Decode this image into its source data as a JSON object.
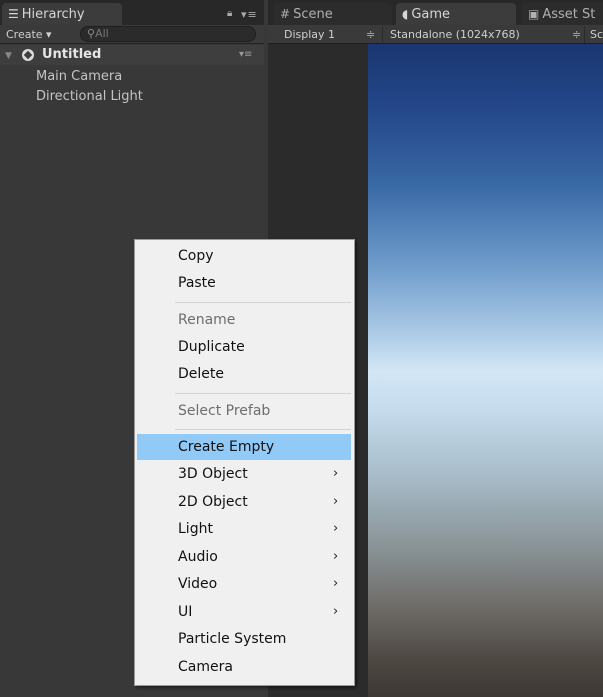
{
  "hierarchy": {
    "tab_label": "Hierarchy",
    "tab_icon": "list-icon",
    "lock_icon": "lock-icon",
    "menu_icon": "▾≡",
    "create_label": "Create ▾",
    "search_placeholder": "All",
    "scene": {
      "name": "Untitled",
      "expand_glyph": "▼",
      "menu_glyph": "▾≡"
    },
    "objects": [
      "Main Camera",
      "Directional Light"
    ]
  },
  "view": {
    "tabs": [
      {
        "label": "Scene",
        "icon": "grid-icon"
      },
      {
        "label": "Game",
        "icon": "pacman-icon"
      },
      {
        "label": "Asset St",
        "icon": "bag-icon"
      }
    ],
    "active_tab": "Game",
    "toolbar": {
      "display": "Display 1",
      "resolution": "Standalone (1024x768)",
      "scale_cut": "Sc",
      "dropdown_glyph": "≑"
    }
  },
  "context_menu": {
    "items": [
      {
        "label": "Copy",
        "enabled": true
      },
      {
        "label": "Paste",
        "enabled": true
      },
      {
        "separator": true
      },
      {
        "label": "Rename",
        "enabled": false
      },
      {
        "label": "Duplicate",
        "enabled": true
      },
      {
        "label": "Delete",
        "enabled": true
      },
      {
        "separator": true
      },
      {
        "label": "Select Prefab",
        "enabled": false
      },
      {
        "separator": true
      },
      {
        "label": "Create Empty",
        "enabled": true,
        "highlighted": true
      },
      {
        "label": "3D Object",
        "enabled": true,
        "submenu": true
      },
      {
        "label": "2D Object",
        "enabled": true,
        "submenu": true
      },
      {
        "label": "Light",
        "enabled": true,
        "submenu": true
      },
      {
        "label": "Audio",
        "enabled": true,
        "submenu": true
      },
      {
        "label": "Video",
        "enabled": true,
        "submenu": true
      },
      {
        "label": "UI",
        "enabled": true,
        "submenu": true
      },
      {
        "label": "Particle System",
        "enabled": true
      },
      {
        "label": "Camera",
        "enabled": true
      }
    ],
    "submenu_glyph": "›",
    "highlight_color": "#91c9f7"
  }
}
